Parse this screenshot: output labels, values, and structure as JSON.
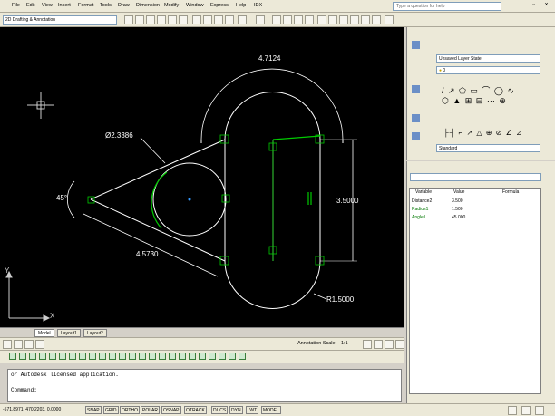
{
  "menu": [
    "File",
    "Edit",
    "View",
    "Insert",
    "Format",
    "Tools",
    "Draw",
    "Dimension",
    "Modify",
    "Window",
    "Express",
    "Help",
    "IDX"
  ],
  "search_placeholder": "Type a question for help",
  "workspace": "2D Drafting & Annotation",
  "drawing": {
    "arc_length": "4.7124",
    "diameter": "Ø2.3386",
    "angle": "45°",
    "aligned_length": "4.5730",
    "distance": "3.5000",
    "radius": "R1.5000"
  },
  "ucs": {
    "x": "X",
    "y": "Y"
  },
  "tabs": [
    "Model",
    "Layout1",
    "Layout2"
  ],
  "annotation_scale_label": "Annotation Scale:",
  "annotation_scale_value": "1:1",
  "command_line": {
    "history": "or Autodesk licensed application.",
    "prompt": "Command:"
  },
  "coordinates": "-571.8971, 470.2203, 0.0000",
  "status_buttons": [
    "SNAP",
    "GRID",
    "ORTHO",
    "POLAR",
    "OSNAP",
    "OTRACK",
    "DUCS",
    "DYN",
    "LWT",
    "MODEL"
  ],
  "dashboard": {
    "layer_state": "Unsaved Layer State",
    "layer": "0",
    "dim_style": "Standard"
  },
  "parameters": {
    "headers": [
      "Variable",
      "Value",
      "Formula"
    ],
    "rows": [
      {
        "name": "Distance2",
        "value": "3.500"
      },
      {
        "name": "Radius1",
        "value": "1.500"
      },
      {
        "name": "Angle1",
        "value": "45.000"
      }
    ]
  },
  "colors": {
    "canvas": "#000000",
    "geometry": "#ffffff",
    "constraint": "#00cc00",
    "ucs": "#cccccc"
  }
}
